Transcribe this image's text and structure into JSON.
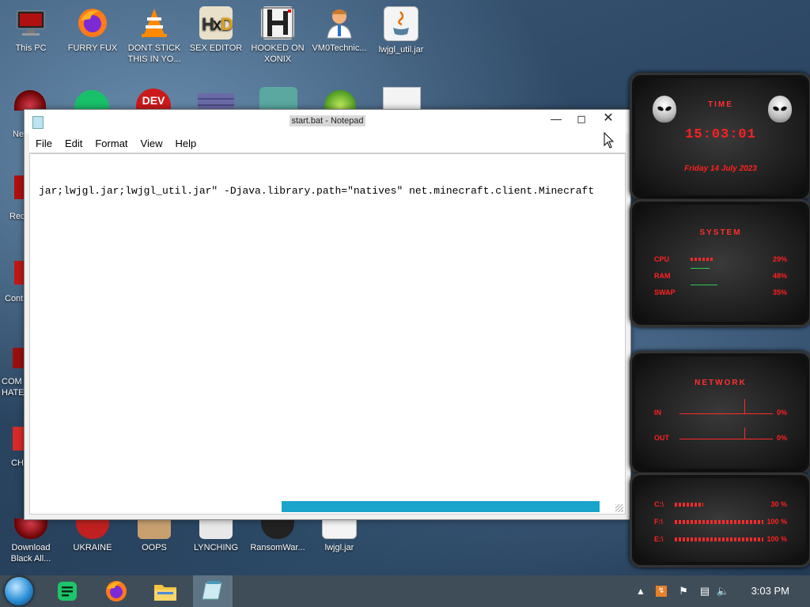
{
  "desktop_icons": [
    {
      "label": "This PC",
      "icon": "monitor-icon"
    },
    {
      "label": "FURRY FUX",
      "icon": "firefox-icon"
    },
    {
      "label": "DONT STICK THIS IN YO...",
      "icon": "vlc-cone-icon"
    },
    {
      "label": "SEX EDITOR",
      "icon": "hxd-icon"
    },
    {
      "label": "HOOKED ON XONIX",
      "icon": "xonix-game-icon"
    },
    {
      "label": "VM0Technic...",
      "icon": "doctor-icon"
    },
    {
      "label": "lwjgl_util.jar",
      "icon": "java-jar-icon"
    },
    {
      "label": "Download Black All...",
      "icon": "red-orb-icon"
    },
    {
      "label": "UKRAINE",
      "icon": "ukraine-icon"
    },
    {
      "label": "OOPS",
      "icon": "oops-icon"
    },
    {
      "label": "LYNCHING",
      "icon": "lynching-icon"
    },
    {
      "label": "RansomWar...",
      "icon": "skull-icon"
    },
    {
      "label": "lwjgl.jar",
      "icon": "java-jar-icon"
    }
  ],
  "partial_labels": [
    "Ne",
    "Rec",
    "Cont",
    "COM HATE",
    "CH"
  ],
  "notepad": {
    "title": "start.bat - Notepad",
    "menu": [
      "File",
      "Edit",
      "Format",
      "View",
      "Help"
    ],
    "content": "jar;lwjgl.jar;lwjgl_util.jar\" -Djava.library.path=\"natives\" net.minecraft.client.Minecraft",
    "horizontal_scroll_position": 0.42
  },
  "widgets": {
    "time": {
      "header": "TIME",
      "clock": "15:03:01",
      "date": "Friday 14 July 2023"
    },
    "system": {
      "header": "SYSTEM",
      "stats": [
        {
          "label": "CPU",
          "value": "29%"
        },
        {
          "label": "RAM",
          "value": "48%"
        },
        {
          "label": "SWAP",
          "value": "35%"
        }
      ]
    },
    "network": {
      "header": "NETWORK",
      "stats": [
        {
          "label": "IN",
          "value": "0%"
        },
        {
          "label": "OUT",
          "value": "0%"
        }
      ]
    },
    "drives": [
      {
        "label": "C:\\",
        "value": "30 %"
      },
      {
        "label": "F:\\",
        "value": "100 %"
      },
      {
        "label": "E:\\",
        "value": "100 %"
      }
    ]
  },
  "taskbar": {
    "items": [
      {
        "name": "start-button",
        "icon": "start-orb-icon"
      },
      {
        "name": "notes-app",
        "icon": "green-notes-icon"
      },
      {
        "name": "firefox",
        "icon": "firefox-icon"
      },
      {
        "name": "file-explorer",
        "icon": "folder-icon"
      },
      {
        "name": "notepad",
        "icon": "notepad-icon",
        "active": true
      }
    ],
    "clock": "3:03 PM"
  },
  "colors": {
    "accent_red": "#ff2020",
    "taskbar": "#3f4d58",
    "scroll_thumb": "#1aa4cc"
  }
}
